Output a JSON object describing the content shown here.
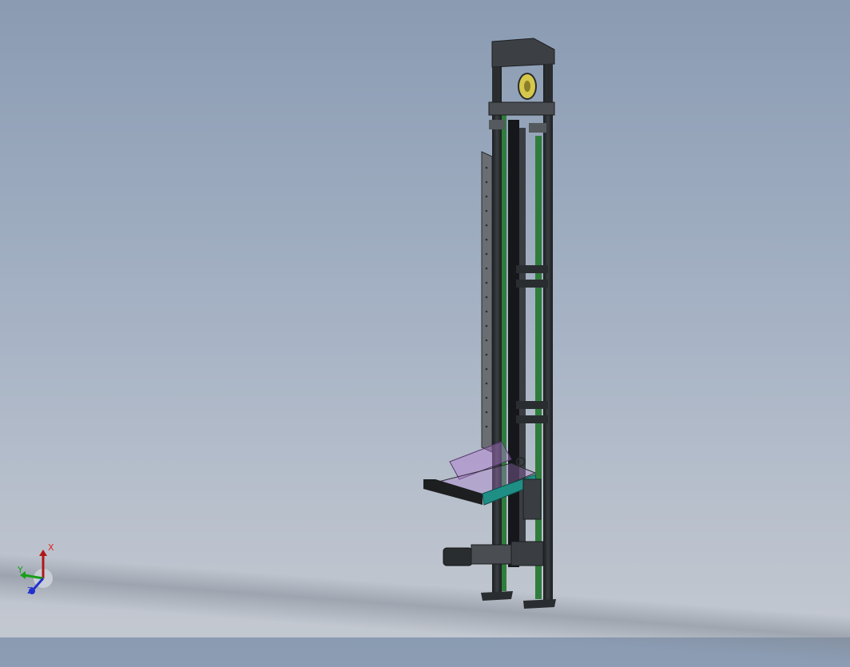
{
  "triad": {
    "x_label": "X",
    "y_label": "Y",
    "z_label": "Z"
  },
  "colors": {
    "frame": "#2a2d30",
    "rail_green": "#2f7d3c",
    "accent_teal": "#1f8f86",
    "glass_purple": "#b07ad0",
    "yellow": "#d6c84a"
  },
  "icons": [
    "coordinate-triad-icon"
  ]
}
